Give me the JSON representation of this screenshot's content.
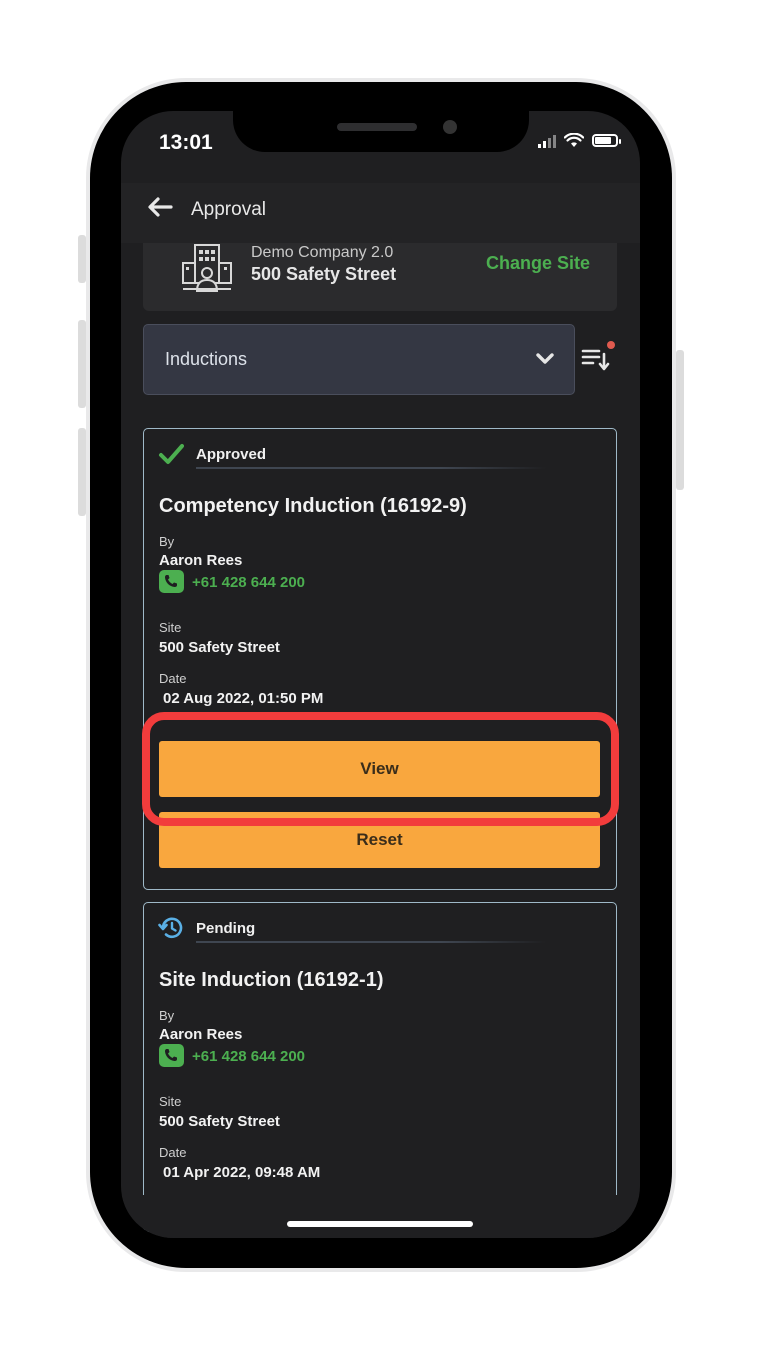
{
  "status_bar": {
    "time": "13:01"
  },
  "header": {
    "title": "Approval"
  },
  "site": {
    "company": "Demo Company 2.0",
    "name": "500 Safety Street",
    "change_label": "Change Site"
  },
  "filter": {
    "selected": "Inductions"
  },
  "cards": [
    {
      "status": "Approved",
      "title": "Competency Induction (16192-9)",
      "by_label": "By",
      "by": "Aaron Rees",
      "phone": "+61 428 644 200",
      "site_label": "Site",
      "site": "500 Safety Street",
      "date_label": "Date",
      "date": "02 Aug 2022, 01:50 PM",
      "view_label": "View",
      "reset_label": "Reset"
    },
    {
      "status": "Pending",
      "title": "Site Induction (16192-1)",
      "by_label": "By",
      "by": "Aaron Rees",
      "phone": "+61 428 644 200",
      "site_label": "Site",
      "site": "500 Safety Street",
      "date_label": "Date",
      "date": "01 Apr 2022, 09:48 AM"
    }
  ],
  "colors": {
    "accent_green": "#4caf50",
    "button_orange": "#f9a73e",
    "highlight_red": "#f23c3c",
    "background": "#1f1f21"
  },
  "icons": [
    "back-arrow-icon",
    "building-icon",
    "chevron-down-icon",
    "sort-icon",
    "check-icon",
    "history-icon",
    "phone-icon"
  ]
}
